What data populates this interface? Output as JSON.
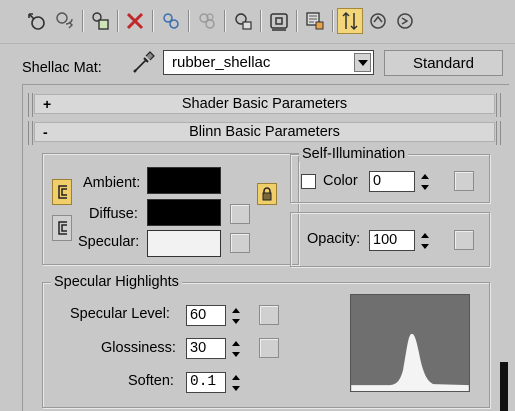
{
  "toolbar": {
    "buttons": [
      {
        "name": "get-material-icon",
        "active": false
      },
      {
        "name": "put-to-scene-icon",
        "active": false
      },
      {
        "name": "assign-material-icon",
        "active": false
      },
      {
        "name": "reset-map-icon",
        "active": false
      },
      {
        "name": "make-copy-icon",
        "active": false
      },
      {
        "name": "make-unique-icon",
        "active": false
      },
      {
        "name": "put-to-library-icon",
        "active": false
      },
      {
        "name": "material-id-channel-icon",
        "active": false
      },
      {
        "name": "show-map-in-viewport-icon",
        "active": false
      },
      {
        "name": "show-end-result-icon",
        "active": true
      },
      {
        "name": "go-to-parent-icon",
        "active": false
      },
      {
        "name": "go-forward-to-sibling-icon",
        "active": false
      }
    ]
  },
  "material": {
    "label": "Shellac Mat:",
    "name": "rubber_shellac",
    "type_button": "Standard"
  },
  "rollouts": {
    "shader": {
      "sign": "+",
      "title": "Shader Basic Parameters"
    },
    "blinn": {
      "sign": "-",
      "title": "Blinn Basic Parameters"
    }
  },
  "colors": {
    "ambient_label": "Ambient:",
    "diffuse_label": "Diffuse:",
    "specular_label": "Specular:",
    "ambient_color": "#000000",
    "diffuse_color": "#000000",
    "specular_color": "#f2f2f2"
  },
  "self_illumination": {
    "title": "Self-Illumination",
    "color_label": "Color",
    "checked": false,
    "value": "0"
  },
  "opacity": {
    "label": "Opacity:",
    "value": "100"
  },
  "specular_highlights": {
    "title": "Specular Highlights",
    "level_label": "Specular Level:",
    "level_value": "60",
    "gloss_label": "Glossiness:",
    "gloss_value": "30",
    "soften_label": "Soften:",
    "soften_value": "0.1"
  },
  "accent": {
    "active_button": "#f0cf6a",
    "curve_bg": "#6f6f6f",
    "curve_fill": "#f4f4f4"
  }
}
